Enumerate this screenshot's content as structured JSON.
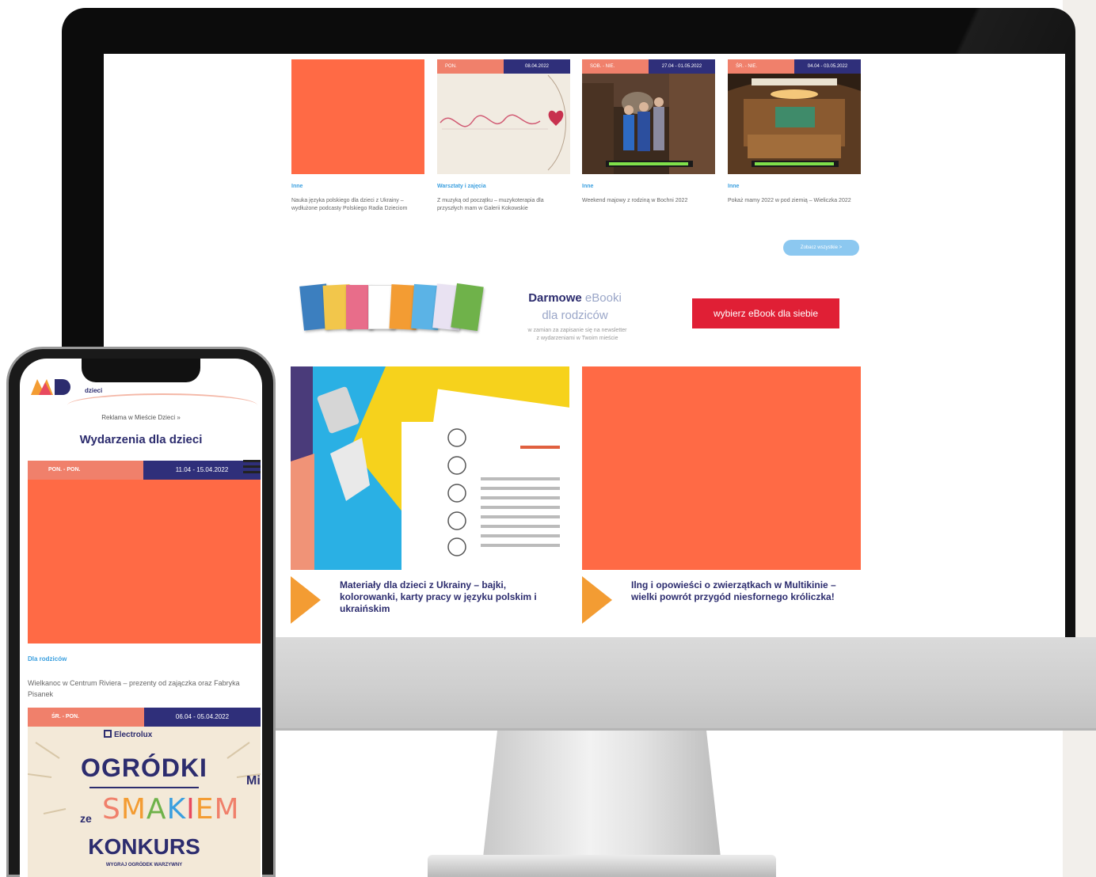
{
  "monitor": {
    "cards": [
      {
        "category": "Inne",
        "title": "Nauka języka polskiego dla dzieci z Ukrainy – wydłużone podcasty Polskiego Radia Dzieciom",
        "tag": "",
        "date": ""
      },
      {
        "category": "Warsztaty i zajęcia",
        "title": "Z muzyką od początku – muzykoterapia dla przyszłych mam w Galerii Kokowskie",
        "tag": "PON.",
        "date": "08.04.2022"
      },
      {
        "category": "Inne",
        "title": "Weekend majowy z rodziną w Bochni 2022",
        "tag": "SOB. - NIE.",
        "date": "27.04 - 01.05.2022"
      },
      {
        "category": "Inne",
        "title": "Pokaż mamy 2022 w pod ziemią – Wieliczka 2022",
        "tag": "ŚR. - NIE.",
        "date": "04.04 - 03.05.2022"
      }
    ],
    "more_button": "Zobacz wszystkie >",
    "ebook": {
      "title_bold": "Darmowe",
      "title_light": "eBooki",
      "subtitle": "dla rodziców",
      "note_line1": "w zamian za zapisanie się na newsletter",
      "note_line2": "z wydarzeniami w Twoim mieście",
      "button": "wybierz eBook dla siebie"
    },
    "features": [
      {
        "title": "Materiały dla dzieci z Ukrainy – bajki, kolorowanki, karty pracy w języku polskim i ukraińskim"
      },
      {
        "title": "Ilng i opowieści o zwierzątkach w Multikinie – wielki powrót przygód niesfornego króliczka!"
      }
    ]
  },
  "phone": {
    "logo_text": "dzieci",
    "ad_line": "Reklama w Mieście Dzieci »",
    "heading": "Wydarzenia dla dzieci",
    "event1": {
      "tag": "PON. - PON.",
      "date": "11.04 - 15.04.2022"
    },
    "event1_category": "Dla rodziców",
    "event1_title": "Wielkanoc w Centrum Riviera – prezenty od zajączka oraz Fabryka Pisanek",
    "event2": {
      "tag": "ŚR. - PON.",
      "date": "06.04 - 05.04.2022"
    },
    "promo": {
      "brand": "Electrolux",
      "big": "OGRÓDKI",
      "ze": "ze",
      "smak": "SMAKIEM",
      "konkurs": "KONKURS",
      "small": "WYGRAJ OGRÓDEK WARZYWNY",
      "side": "Mi"
    }
  },
  "colors": {
    "orange": "#ff6a45",
    "navy": "#2c2c6e",
    "salmon": "#f0806b",
    "blue": "#3a9fdf",
    "red": "#e01f35",
    "amber": "#f39c33"
  }
}
